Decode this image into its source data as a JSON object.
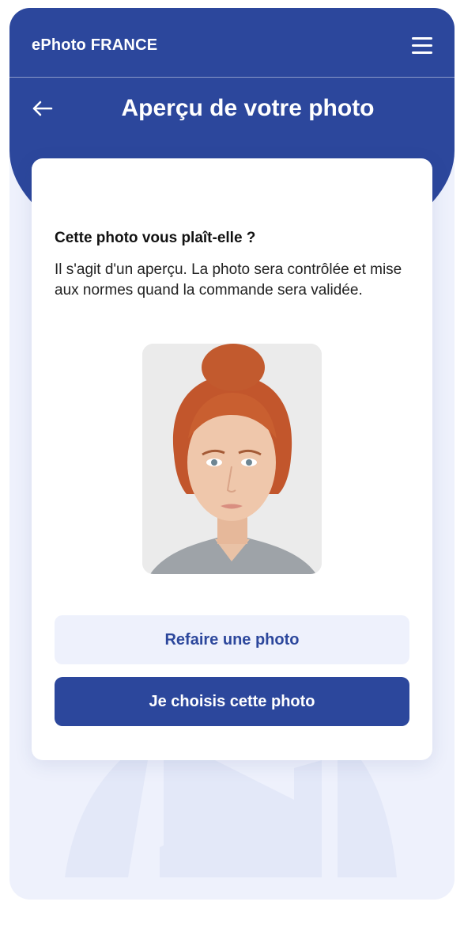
{
  "app": {
    "brand": "ePhoto FRANCE"
  },
  "header": {
    "title": "Aperçu de votre photo"
  },
  "card": {
    "question": "Cette photo vous plaît-elle ?",
    "description": "Il s'agit d'un aperçu. La photo sera contrôlée et mise aux normes quand la commande sera validée."
  },
  "actions": {
    "retake_label": "Refaire une photo",
    "choose_label": "Je choisis cette photo"
  },
  "icons": {
    "menu": "hamburger-menu-icon",
    "back": "arrow-left-icon"
  },
  "colors": {
    "brand_blue": "#2c479c",
    "background": "#eef1fc",
    "card": "#ffffff"
  }
}
